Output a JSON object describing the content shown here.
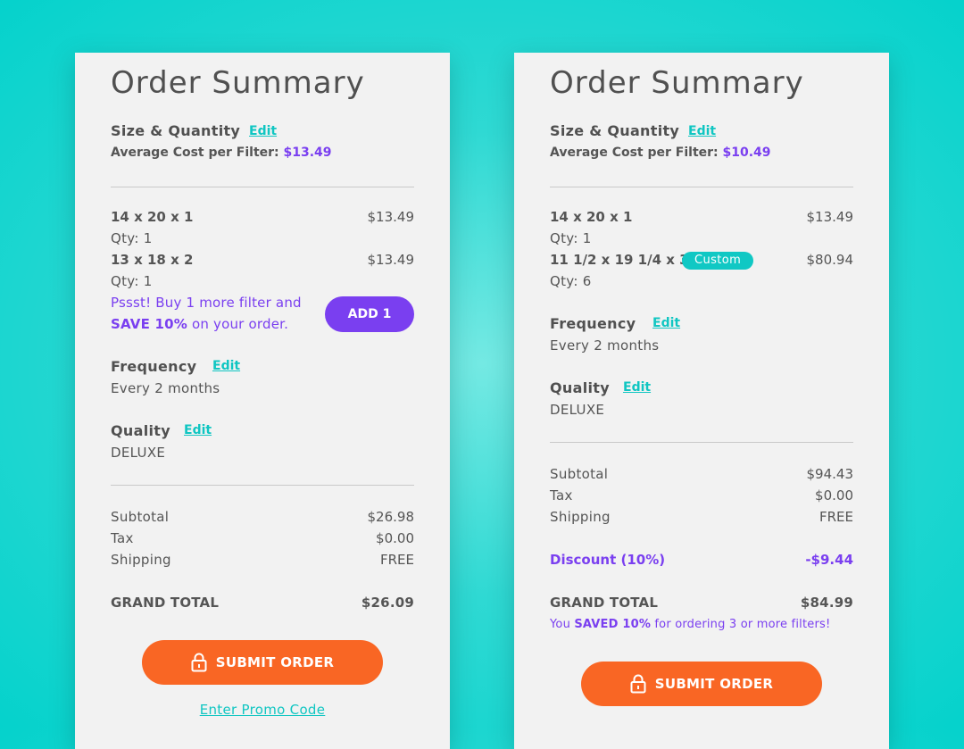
{
  "colors": {
    "background": "#05d2cc",
    "card": "#f2f2f2",
    "accent_teal": "#10c6c2",
    "accent_purple": "#7a3ff0",
    "submit_orange": "#f96624"
  },
  "left": {
    "title": "Order Summary",
    "size_quantity_label": "Size & Quantity",
    "edit_label": "Edit",
    "avg_cost_label": "Average Cost per Filter:",
    "avg_cost_value": "$13.49",
    "items": [
      {
        "name": "14 x 20 x 1",
        "qty": "Qty: 1",
        "price": "$13.49"
      },
      {
        "name": "13 x 18 x 2",
        "qty": "Qty: 1",
        "price": "$13.49"
      }
    ],
    "promo_line1": "Pssst! Buy 1 more filter and",
    "promo_save": "SAVE 10%",
    "promo_rest": " on your order.",
    "add_button": "ADD 1",
    "frequency_label": "Frequency",
    "frequency_value": "Every 2 months",
    "quality_label": "Quality",
    "quality_value": "DELUXE",
    "subtotal_label": "Subtotal",
    "subtotal_value": "$26.98",
    "tax_label": "Tax",
    "tax_value": "$0.00",
    "shipping_label": "Shipping",
    "shipping_value": "FREE",
    "grand_total_label": "GRAND TOTAL",
    "grand_total_value": "$26.09",
    "submit_label": "SUBMIT ORDER",
    "promo_code_link": "Enter Promo Code"
  },
  "right": {
    "title": "Order Summary",
    "size_quantity_label": "Size & Quantity",
    "edit_label": "Edit",
    "avg_cost_label": "Average Cost per Filter:",
    "avg_cost_value": "$10.49",
    "items": [
      {
        "name": "14 x 20 x 1",
        "qty": "Qty: 1",
        "price": "$13.49"
      },
      {
        "name": "11 1/2 x 19 1/4 x 3",
        "badge": "Custom",
        "qty": "Qty: 6",
        "price": "$80.94"
      }
    ],
    "frequency_label": "Frequency",
    "frequency_value": "Every 2 months",
    "quality_label": "Quality",
    "quality_value": "DELUXE",
    "subtotal_label": "Subtotal",
    "subtotal_value": "$94.43",
    "tax_label": "Tax",
    "tax_value": "$0.00",
    "shipping_label": "Shipping",
    "shipping_value": "FREE",
    "discount_label": "Discount (10%)",
    "discount_value": "-$9.44",
    "grand_total_label": "GRAND TOTAL",
    "grand_total_value": "$84.99",
    "saved_prefix": "You ",
    "saved_bold": "SAVED 10%",
    "saved_rest": " for ordering 3 or more filters!",
    "submit_label": "SUBMIT ORDER"
  }
}
